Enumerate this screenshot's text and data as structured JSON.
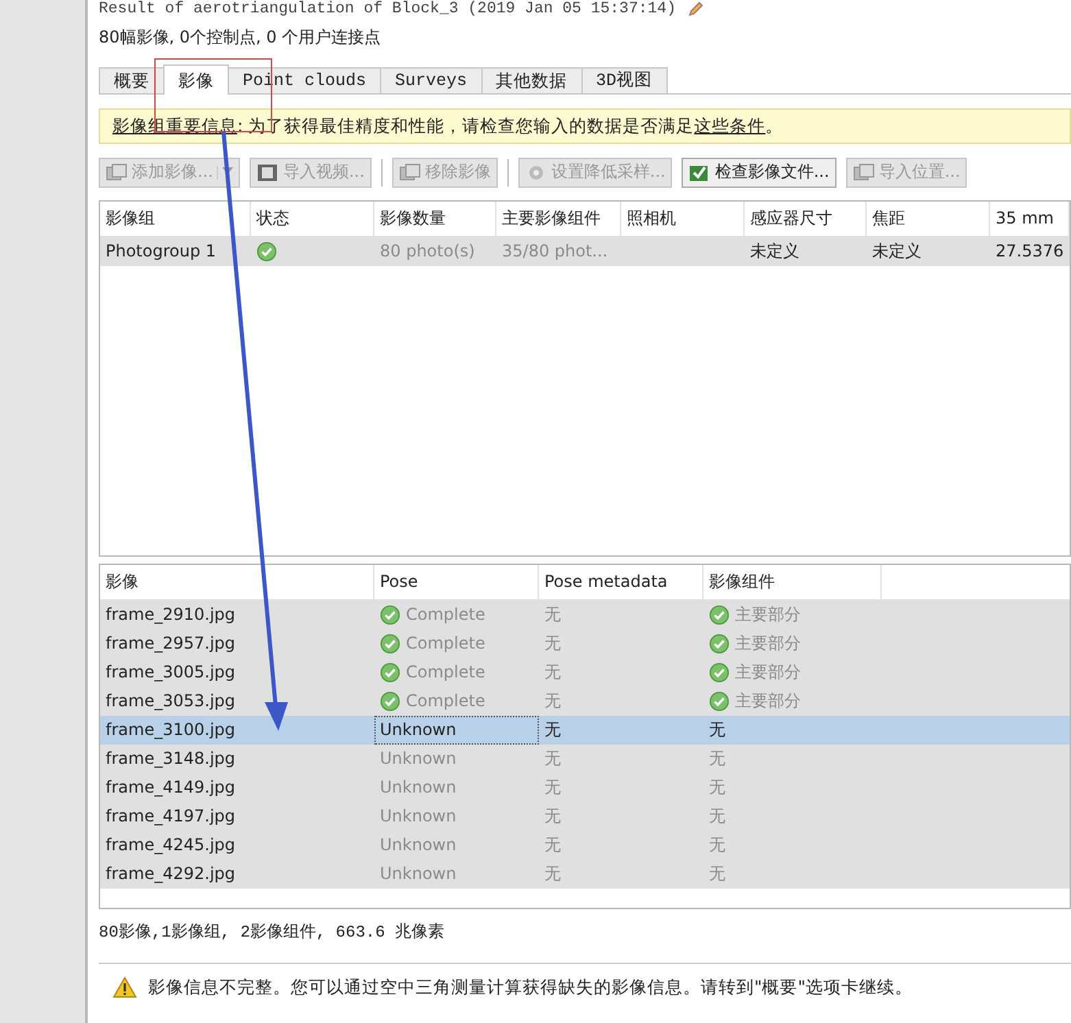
{
  "header": {
    "title": "Result of aerotriangulation of Block_3 (2019 Jan 05 15:37:14)",
    "summary": "80幅影像, 0个控制点, 0 个用户连接点"
  },
  "tabs": [
    {
      "label": "概要",
      "selected": false
    },
    {
      "label": "影像",
      "selected": true
    },
    {
      "label": "Point clouds",
      "selected": false
    },
    {
      "label": "Surveys",
      "selected": false
    },
    {
      "label": "其他数据",
      "selected": false
    },
    {
      "label": "3D视图",
      "selected": false
    }
  ],
  "info_bar": {
    "heading": "影像组重要信息",
    "text": ": 为了获得最佳精度和性能，请检查您输入的数据是否满足",
    "link": "这些条件",
    "end": "。"
  },
  "toolbar": [
    {
      "label": "添加影像...",
      "disabled": true,
      "dropdown": true
    },
    {
      "label": "导入视频...",
      "disabled": true,
      "dropdown": false
    },
    {
      "label": "移除影像",
      "disabled": true,
      "dropdown": false
    },
    {
      "label": "设置降低采样...",
      "disabled": true,
      "dropdown": false
    },
    {
      "label": "检查影像文件...",
      "disabled": false,
      "dropdown": false
    },
    {
      "label": "导入位置...",
      "disabled": true,
      "dropdown": false
    }
  ],
  "groups_table": {
    "columns": [
      "影像组",
      "状态",
      "影像数量",
      "主要影像组件",
      "照相机",
      "感应器尺寸",
      "焦距",
      "35 mm"
    ],
    "rows": [
      {
        "cells": [
          "Photogroup 1",
          "",
          "80 photo(s)",
          "35/80 phot...",
          "",
          "未定义",
          "未定义",
          "27.5376"
        ],
        "status_ok": true
      }
    ]
  },
  "photos_table": {
    "columns": [
      "影像",
      "Pose",
      "Pose metadata",
      "影像组件"
    ],
    "rows": [
      {
        "name": "frame_2910.jpg",
        "pose": "Complete",
        "pose_ok": true,
        "metadata": "无",
        "component": "主要部分",
        "component_ok": true,
        "selected": false
      },
      {
        "name": "frame_2957.jpg",
        "pose": "Complete",
        "pose_ok": true,
        "metadata": "无",
        "component": "主要部分",
        "component_ok": true,
        "selected": false
      },
      {
        "name": "frame_3005.jpg",
        "pose": "Complete",
        "pose_ok": true,
        "metadata": "无",
        "component": "主要部分",
        "component_ok": true,
        "selected": false
      },
      {
        "name": "frame_3053.jpg",
        "pose": "Complete",
        "pose_ok": true,
        "metadata": "无",
        "component": "主要部分",
        "component_ok": true,
        "selected": false
      },
      {
        "name": "frame_3100.jpg",
        "pose": "Unknown",
        "pose_ok": false,
        "metadata": "无",
        "component": "无",
        "component_ok": false,
        "selected": true
      },
      {
        "name": "frame_3148.jpg",
        "pose": "Unknown",
        "pose_ok": false,
        "metadata": "无",
        "component": "无",
        "component_ok": false,
        "selected": false
      },
      {
        "name": "frame_4149.jpg",
        "pose": "Unknown",
        "pose_ok": false,
        "metadata": "无",
        "component": "无",
        "component_ok": false,
        "selected": false
      },
      {
        "name": "frame_4197.jpg",
        "pose": "Unknown",
        "pose_ok": false,
        "metadata": "无",
        "component": "无",
        "component_ok": false,
        "selected": false
      },
      {
        "name": "frame_4245.jpg",
        "pose": "Unknown",
        "pose_ok": false,
        "metadata": "无",
        "component": "无",
        "component_ok": false,
        "selected": false
      },
      {
        "name": "frame_4292.jpg",
        "pose": "Unknown",
        "pose_ok": false,
        "metadata": "无",
        "component": "无",
        "component_ok": false,
        "selected": false
      }
    ]
  },
  "status_line": "80影像,1影像组, 2影像组件, 663.6 兆像素",
  "warning": "影像信息不完整。您可以通过空中三角测量计算获得缺失的影像信息。请转到\"概要\"选项卡继续。"
}
